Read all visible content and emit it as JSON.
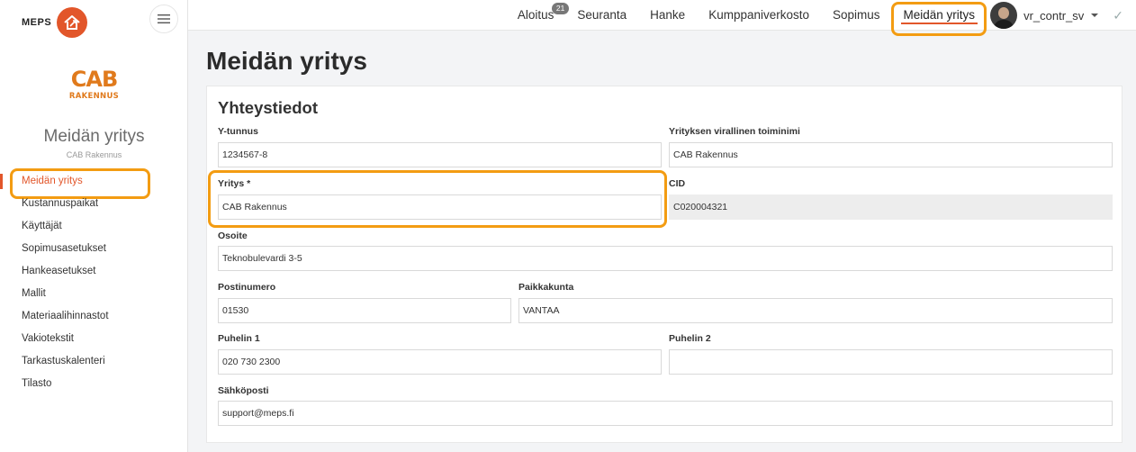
{
  "brand": {
    "name": "MEPS"
  },
  "company_logo": {
    "line1": "CAB",
    "line2": "RAKENNUS"
  },
  "sidebar": {
    "title": "Meidän yritys",
    "subtitle": "CAB Rakennus",
    "items": [
      {
        "label": "Meidän yritys",
        "active": true
      },
      {
        "label": "Kustannuspaikat"
      },
      {
        "label": "Käyttäjät"
      },
      {
        "label": "Sopimusasetukset"
      },
      {
        "label": "Hankeasetukset"
      },
      {
        "label": "Mallit"
      },
      {
        "label": "Materiaalihinnastot"
      },
      {
        "label": "Vakiotekstit"
      },
      {
        "label": "Tarkastuskalenteri"
      },
      {
        "label": "Tilasto"
      }
    ]
  },
  "topnav": {
    "items": [
      {
        "label": "Aloitus",
        "badge": "21"
      },
      {
        "label": "Seuranta"
      },
      {
        "label": "Hanke"
      },
      {
        "label": "Kumppaniverkosto"
      },
      {
        "label": "Sopimus"
      },
      {
        "label": "Meidän yritys",
        "active": true
      }
    ],
    "username": "vr_contr_sv",
    "check_glyph": "✓"
  },
  "page": {
    "title": "Meidän yritys"
  },
  "form": {
    "section_title": "Yhteystiedot",
    "fields": {
      "y_tunnus": {
        "label": "Y-tunnus",
        "value": "1234567-8"
      },
      "virallinen_nimi": {
        "label": "Yrityksen virallinen toiminimi",
        "value": "CAB Rakennus"
      },
      "yritys": {
        "label": "Yritys *",
        "value": "CAB Rakennus"
      },
      "cid": {
        "label": "CID",
        "value": "C020004321"
      },
      "osoite": {
        "label": "Osoite",
        "value": "Teknobulevardi 3-5"
      },
      "postinumero": {
        "label": "Postinumero",
        "value": "01530"
      },
      "paikkakunta": {
        "label": "Paikkakunta",
        "value": "VANTAA"
      },
      "puhelin1": {
        "label": "Puhelin 1",
        "value": "020 730 2300"
      },
      "puhelin2": {
        "label": "Puhelin 2",
        "value": ""
      },
      "sahkoposti": {
        "label": "Sähköposti",
        "value": "support@meps.fi"
      }
    }
  },
  "colors": {
    "accent": "#e2562a",
    "highlight": "#f39c12"
  }
}
